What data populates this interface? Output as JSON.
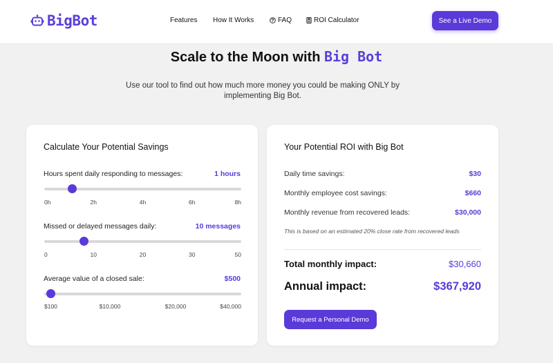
{
  "nav": {
    "logo_text": "BigBot",
    "links": [
      {
        "label": "Features",
        "icon": ""
      },
      {
        "label": "How It Works",
        "icon": ""
      },
      {
        "label": "FAQ",
        "icon": "question-circle-icon"
      },
      {
        "label": "ROI Calculator",
        "icon": "calculator-icon"
      }
    ],
    "cta": "See a Live Demo"
  },
  "hero": {
    "title_prefix": "Scale to the Moon with",
    "title_brand": "Big Bot",
    "subtitle": "Use our tool to find out how much more money you could be making ONLY by implementing Big Bot."
  },
  "calculator": {
    "title": "Calculate Your Potential Savings",
    "sliders": [
      {
        "label": "Hours spent daily responding to messages:",
        "value_text": "1 hours",
        "fraction": 0.14,
        "ticks": [
          "0h",
          "2h",
          "4h",
          "6h",
          "8h"
        ]
      },
      {
        "label": "Missed or delayed messages daily:",
        "value_text": "10 messages",
        "fraction": 0.2,
        "ticks": [
          "0",
          "10",
          "20",
          "30",
          "50"
        ]
      },
      {
        "label": "Average value of a closed sale:",
        "value_text": "$500",
        "fraction": 0.03,
        "ticks": [
          "$100",
          "$10,000",
          "$20,000",
          "$40,000"
        ]
      }
    ]
  },
  "roi": {
    "title": "Your Potential ROI with Big Bot",
    "rows": [
      {
        "label": "Daily time savings:",
        "value": "$30"
      },
      {
        "label": "Monthly employee cost savings:",
        "value": "$660"
      },
      {
        "label": "Monthly revenue from recovered leads:",
        "value": "$30,000"
      }
    ],
    "note": "This is based on an estimated 20% close rate from recovered leads",
    "total_label": "Total monthly impact:",
    "total_value": "$30,660",
    "annual_label": "Annual impact:",
    "annual_value": "$367,920",
    "cta": "Request a Personal Demo"
  },
  "colors": {
    "accent": "#5a3ad9",
    "background": "#f1f1f2",
    "card": "#ffffff"
  }
}
